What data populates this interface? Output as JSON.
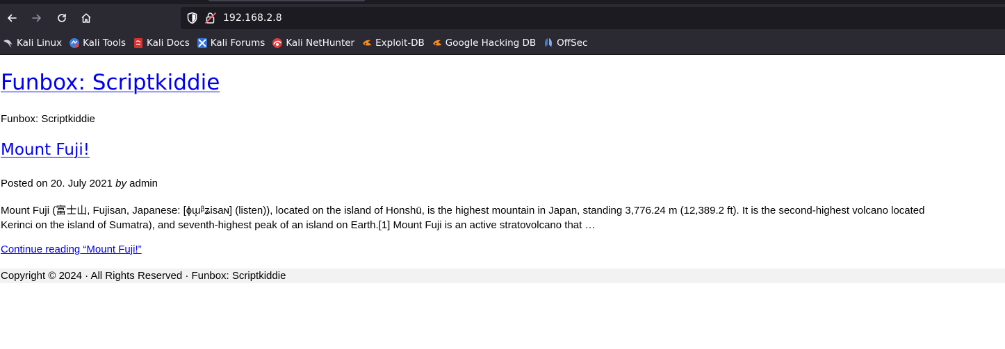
{
  "browser": {
    "url": "192.168.2.8",
    "nav": {
      "back_icon": "back-arrow-icon",
      "forward_icon": "forward-arrow-icon",
      "reload_icon": "reload-icon",
      "home_icon": "home-icon"
    },
    "bookmarks": [
      {
        "label": "Kali Linux",
        "icon": "kali-dragon-icon"
      },
      {
        "label": "Kali Tools",
        "icon": "kali-tools-icon"
      },
      {
        "label": "Kali Docs",
        "icon": "kali-docs-icon"
      },
      {
        "label": "Kali Forums",
        "icon": "kali-forums-icon"
      },
      {
        "label": "Kali NetHunter",
        "icon": "kali-nethunter-icon"
      },
      {
        "label": "Exploit-DB",
        "icon": "exploit-db-icon"
      },
      {
        "label": "Google Hacking DB",
        "icon": "google-hacking-db-icon"
      },
      {
        "label": "OffSec",
        "icon": "offsec-icon"
      }
    ]
  },
  "page": {
    "site_title": "Funbox: Scriptkiddie",
    "tagline": "Funbox: Scriptkiddie",
    "post": {
      "title": "Mount Fuji!",
      "posted_on": "Posted on 20. July 2021",
      "by": "by",
      "author": "admin",
      "excerpt_line1": "Mount Fuji (富士山, Fujisan, Japanese: [ɸɯ̟ᵝʑisaɴ] (listen)), located on the island of Honshū, is the highest mountain in Japan, standing 3,776.24 m (12,389.2 ft). It is the second-highest volcano located",
      "excerpt_line2": "Kerinci on the island of Sumatra), and seventh-highest peak of an island on Earth.[1] Mount Fuji is an active stratovolcano that …",
      "continue_label": "Continue reading “Mount Fuji!”"
    },
    "footer": "Copyright © 2024 · All Rights Reserved · Funbox: Scriptkiddie"
  },
  "colors": {
    "link": "#0000ee",
    "chrome_bg": "#2b2a33",
    "urlbar_bg": "#1c1b22",
    "footer_bg": "#f2f2f2"
  }
}
